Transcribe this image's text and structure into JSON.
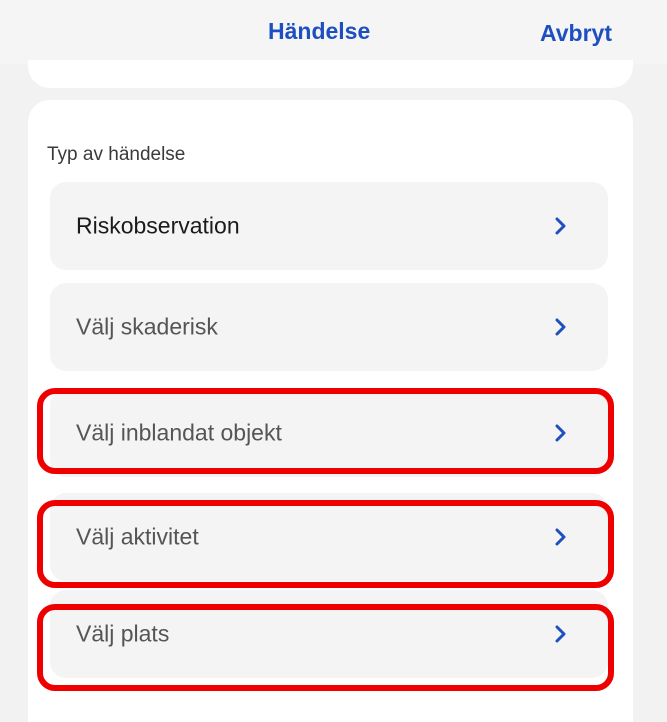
{
  "header": {
    "title": "Händelse",
    "cancel_label": "Avbryt"
  },
  "section": {
    "label": "Typ av händelse"
  },
  "rows": [
    {
      "label": "Riskobservation",
      "selected": true
    },
    {
      "label": "Välj skaderisk",
      "selected": false
    },
    {
      "label": "Välj inblandat objekt",
      "selected": false
    },
    {
      "label": "Välj aktivitet",
      "selected": false
    },
    {
      "label": "Välj plats",
      "selected": false
    }
  ],
  "highlighted_rows": [
    "Välj inblandat objekt",
    "Välj aktivitet",
    "Välj plats"
  ],
  "colors": {
    "accent": "#1e4fc0",
    "highlight": "#ee0000",
    "row_background": "#f4f4f4",
    "card_background": "#ffffff",
    "page_background": "#f2f2f2"
  },
  "icons": {
    "chevron": "chevron-right-icon"
  }
}
